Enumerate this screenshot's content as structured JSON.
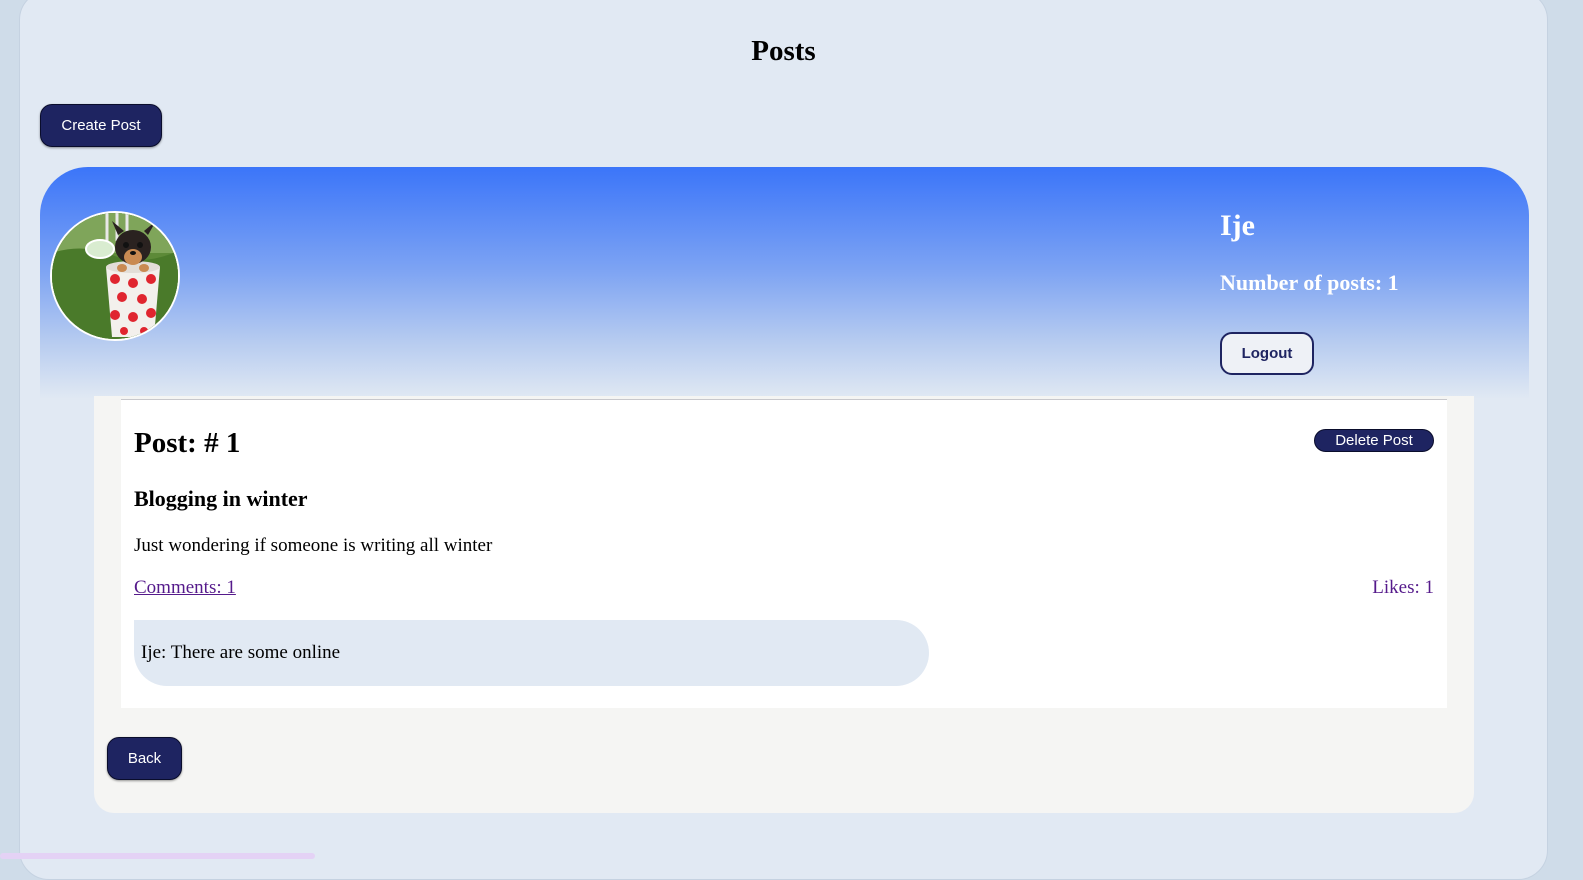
{
  "page": {
    "title": "Posts"
  },
  "toolbar": {
    "create_post_label": "Create Post"
  },
  "profile": {
    "username": "Ije",
    "post_count_text": "Number of posts: 1",
    "logout_label": "Logout"
  },
  "post": {
    "number_text": "Post: # 1",
    "delete_label": "Delete Post",
    "title": "Blogging in winter",
    "body": "Just wondering if someone is writing all winter",
    "comments_text": "Comments: 1",
    "likes_text": "Likes: 1",
    "comment_text": "Ije: There are some online"
  },
  "footer": {
    "back_label": "Back"
  },
  "colors": {
    "accent": "#1e2461",
    "banner_top": "#3b75f9",
    "page_bg": "#e1e9f3",
    "link": "#551a8b"
  }
}
